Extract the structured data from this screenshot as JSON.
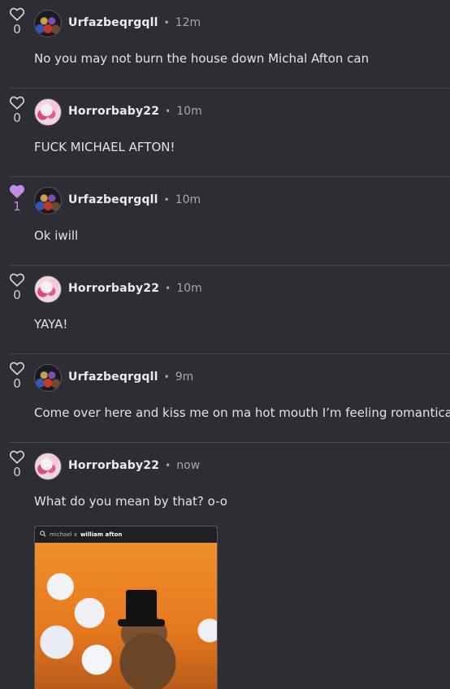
{
  "comments": [
    {
      "likes": "0",
      "liked": false,
      "avatar": "freddy-avatar",
      "username": "Urfazbeqrgqll",
      "time": "12m",
      "text": "No you may not burn the house down Michal Afton can"
    },
    {
      "likes": "0",
      "liked": false,
      "avatar": "horror-avatar",
      "username": "Horrorbaby22",
      "time": "10m",
      "text": "FUCK MICHAEL AFTON!"
    },
    {
      "likes": "1",
      "liked": true,
      "avatar": "freddy-avatar",
      "username": "Urfazbeqrgqll",
      "time": "10m",
      "text": "Ok iwill"
    },
    {
      "likes": "0",
      "liked": false,
      "avatar": "horror-avatar",
      "username": "Horrorbaby22",
      "time": "10m",
      "text": "YAYA!"
    },
    {
      "likes": "0",
      "liked": false,
      "avatar": "freddy-avatar",
      "username": "Urfazbeqrgqll",
      "time": "9m",
      "text": "Come over here and kiss me on ma hot mouth I’m feeling romanticall"
    },
    {
      "likes": "0",
      "liked": false,
      "avatar": "horror-avatar",
      "username": "Horrorbaby22",
      "time": "now",
      "text": "What do you mean by that? o-o"
    }
  ],
  "separator": "•",
  "attachment": {
    "search_query": "michael x",
    "search_bold": "william afton"
  },
  "colors": {
    "background": "#2d2e33",
    "liked_heart": "#c58be8",
    "divider": "#4a4b51"
  }
}
